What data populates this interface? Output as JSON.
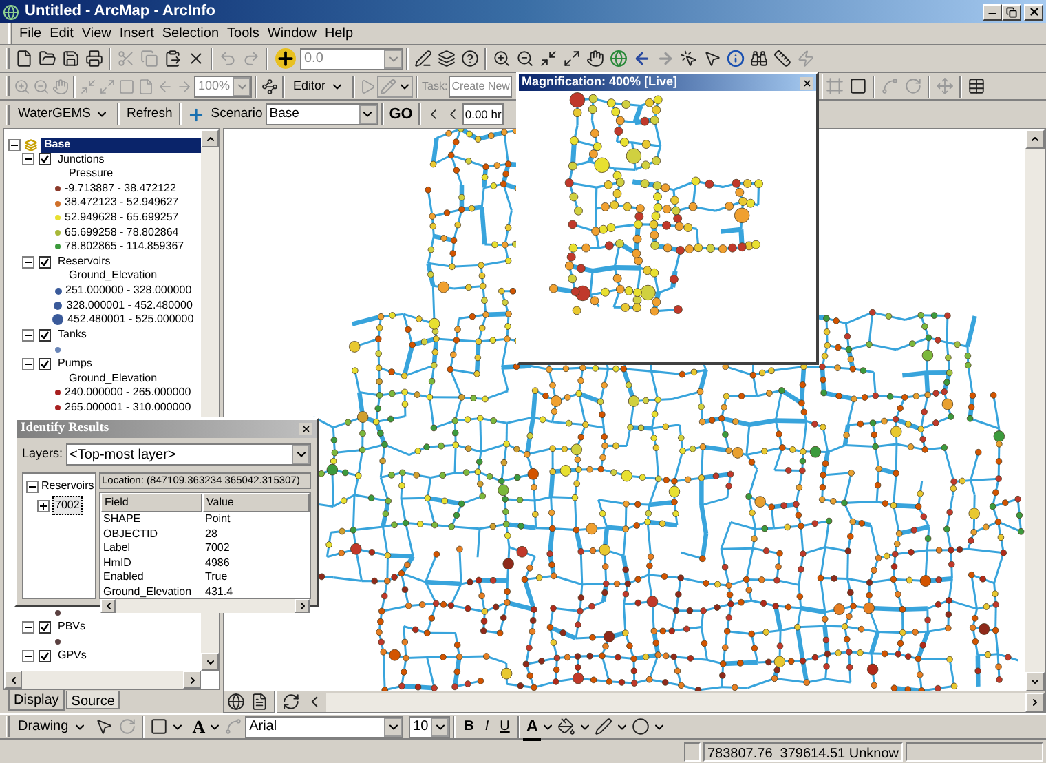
{
  "window": {
    "title": "Untitled - ArcMap - ArcInfo"
  },
  "menu": [
    "File",
    "Edit",
    "View",
    "Insert",
    "Selection",
    "Tools",
    "Window",
    "Help"
  ],
  "standard_toolbar": {
    "scale_value": "0.0"
  },
  "layout_toolbar": {
    "zoom_value": "100%"
  },
  "editor_toolbar": {
    "menu": "Editor",
    "task_label": "Task:",
    "task_value": "Create New"
  },
  "watergems_toolbar": {
    "menu": "WaterGEMS",
    "refresh": "Refresh",
    "scenario_label": "Scenario",
    "scenario_value": "Base",
    "go": "GO",
    "time_value": "0.00 hr"
  },
  "toc": {
    "root": {
      "label": "Base",
      "expanded": true,
      "selected": true
    },
    "layers": [
      {
        "kind": "layer",
        "name": "Junctions",
        "checked": true,
        "expanded": true,
        "field": "Pressure",
        "classes": [
          {
            "label": "-9.713887 - 38.472122",
            "color": "#8b3a2a"
          },
          {
            "label": "38.472123 - 52.949627",
            "color": "#d0702a"
          },
          {
            "label": "52.949628 - 65.699257",
            "color": "#e8e030"
          },
          {
            "label": "65.699258 - 78.802864",
            "color": "#a8b838"
          },
          {
            "label": "78.802865 - 114.859367",
            "color": "#3c9a3c"
          }
        ]
      },
      {
        "kind": "graduated",
        "name": "Reservoirs",
        "checked": true,
        "expanded": true,
        "field": "Ground_Elevation",
        "classes": [
          {
            "label": "251.000000 - 328.000000",
            "color": "#3a5a9a"
          },
          {
            "label": "328.000001 - 452.480000",
            "color": "#3a5a9a"
          },
          {
            "label": "452.480001 - 525.000000",
            "color": "#3a5a9a"
          }
        ]
      },
      {
        "kind": "layer",
        "name": "Tanks",
        "checked": true,
        "expanded": true,
        "classes": [
          {
            "color": "#6a86b8"
          }
        ]
      },
      {
        "kind": "layer",
        "name": "Pumps",
        "checked": true,
        "expanded": true,
        "field": "Ground_Elevation",
        "classes": [
          {
            "label": "240.000000 - 265.000000",
            "color": "#a82020"
          },
          {
            "label": "265.000001 - 310.000000",
            "color": "#a82020"
          }
        ]
      },
      {
        "kind": "symbol",
        "color": "#5a4040"
      },
      {
        "kind": "layer",
        "name": "PBVs",
        "checked": true,
        "expanded": true,
        "classes": [
          {
            "color": "#5a4040"
          }
        ]
      },
      {
        "kind": "layer",
        "name": "GPVs",
        "checked": true,
        "expanded": true
      }
    ],
    "tabs": [
      {
        "label": "Display",
        "selected": true
      },
      {
        "label": "Source",
        "selected": false
      }
    ]
  },
  "identify": {
    "title": "Identify Results",
    "layers_label": "Layers:",
    "layers_value": "<Top-most layer>",
    "tree": [
      {
        "label": "Reservoirs",
        "expanded": true,
        "children": [
          {
            "label": "7002",
            "expanded": false,
            "selected": true
          }
        ]
      }
    ],
    "location": "Location: (847109.363234 365042.315307)",
    "columns": [
      "Field",
      "Value"
    ],
    "rows": [
      [
        "SHAPE",
        "Point"
      ],
      [
        "OBJECTID",
        "28"
      ],
      [
        "Label",
        "7002"
      ],
      [
        "HmID",
        "4986"
      ],
      [
        "Enabled",
        "True"
      ],
      [
        "Ground_Elevation",
        "431.4"
      ]
    ]
  },
  "magnifier": {
    "title": "Magnification: 400% [Live]"
  },
  "drawing_toolbar": {
    "menu": "Drawing",
    "text_tool": "A",
    "font": "Arial",
    "size": "10",
    "bold": "B",
    "italic": "I",
    "underline": "U",
    "font_color": "A"
  },
  "status_bar": {
    "coordinates": "783807.76  379614.51 Unknow"
  }
}
